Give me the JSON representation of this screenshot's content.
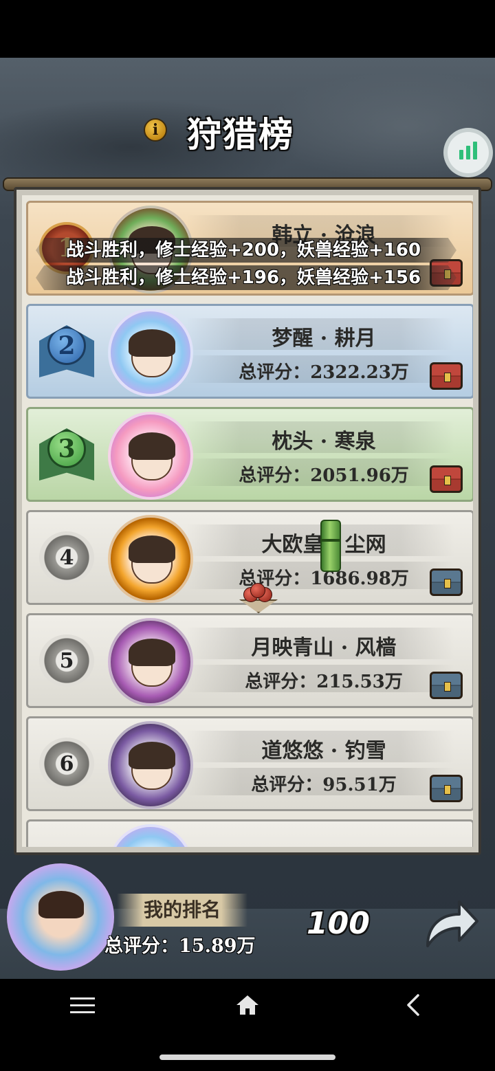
{
  "header": {
    "title": "狩猎榜",
    "info_icon": "info-icon",
    "stats_icon": "bar-chart-icon"
  },
  "toasts": [
    "战斗胜利，修士经验+200，妖兽经验+160",
    "战斗胜利，修士经验+196，妖兽经验+156"
  ],
  "leaderboard": {
    "rows": [
      {
        "rank": "1",
        "name": "韩立 · 沧浪",
        "score": "",
        "chest": "red-chest-icon"
      },
      {
        "rank": "2",
        "name": "梦醒 · 耕月",
        "score": "总评分：2322.23万",
        "chest": "red-chest-icon"
      },
      {
        "rank": "3",
        "name": "枕头 · 寒泉",
        "score": "总评分：2051.96万",
        "chest": "red-chest-icon"
      },
      {
        "rank": "4",
        "name": "大欧皇 · 尘网",
        "score": "总评分：1686.98万",
        "chest": "blue-chest-icon"
      },
      {
        "rank": "5",
        "name": "月映青山 · 风樯",
        "score": "总评分：215.53万",
        "chest": "blue-chest-icon"
      },
      {
        "rank": "6",
        "name": "道悠悠 · 钓雪",
        "score": "总评分：95.51万",
        "chest": "blue-chest-icon"
      }
    ]
  },
  "my_rank": {
    "label": "我的排名",
    "score": "总评分：15.89万",
    "rank": "100",
    "share_icon": "share-arrow-icon"
  },
  "nav": {
    "menu_icon": "menu-icon",
    "home_icon": "home-icon",
    "back_icon": "back-icon"
  },
  "colors": {
    "gold_row": "#ebc998",
    "silver_row": "#b5cde2",
    "bronze_row": "#bad6a6",
    "plain_row": "#dddbd3",
    "stats_green": "#2fbf7a"
  }
}
